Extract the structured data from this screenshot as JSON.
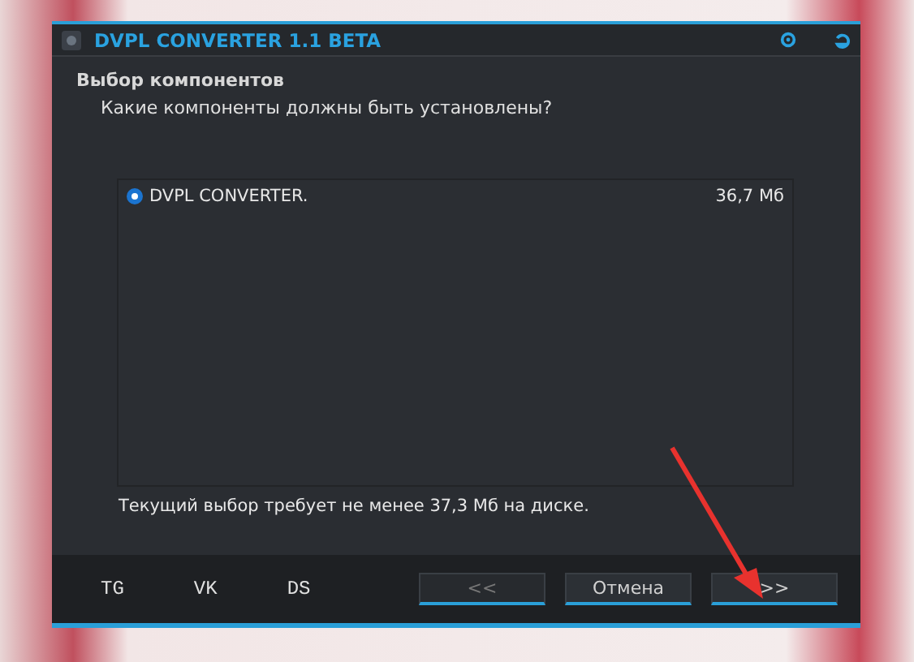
{
  "window": {
    "title": "DVPL CONVERTER 1.1 BETA"
  },
  "header": {
    "title": "Выбор компонентов",
    "subtitle": "Какие компоненты должны быть установлены?"
  },
  "components": [
    {
      "name": "DVPL CONVERTER.",
      "size": "36,7 Мб",
      "selected": true
    }
  ],
  "disk_note": "Текущий выбор требует не менее 37,3 Мб на диске.",
  "links": [
    "TG",
    "VK",
    "DS"
  ],
  "buttons": [
    {
      "label": "<<",
      "disabled": true
    },
    {
      "label": "Отмена",
      "disabled": false
    },
    {
      "label": ">>",
      "disabled": false
    }
  ]
}
